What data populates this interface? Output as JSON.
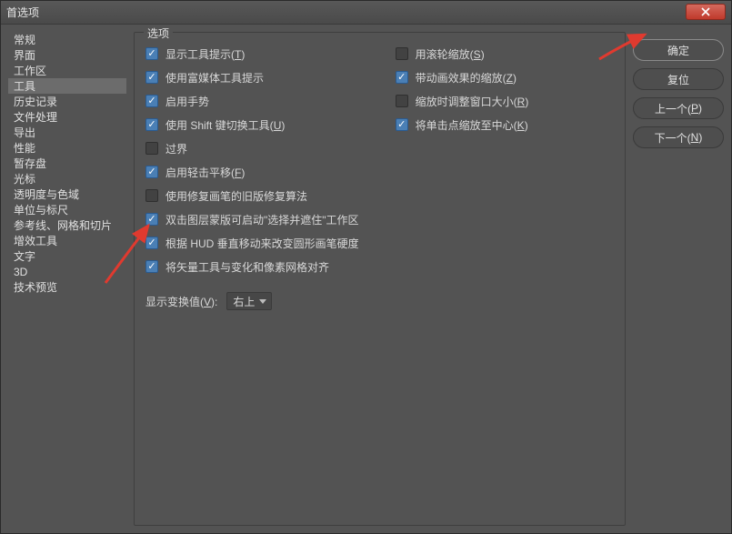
{
  "title": "首选项",
  "sidebar": {
    "items": [
      {
        "label": "常规"
      },
      {
        "label": "界面"
      },
      {
        "label": "工作区"
      },
      {
        "label": "工具",
        "selected": true
      },
      {
        "label": "历史记录"
      },
      {
        "label": "文件处理"
      },
      {
        "label": "导出"
      },
      {
        "label": "性能"
      },
      {
        "label": "暂存盘"
      },
      {
        "label": "光标"
      },
      {
        "label": "透明度与色域"
      },
      {
        "label": "单位与标尺"
      },
      {
        "label": "参考线、网格和切片"
      },
      {
        "label": "增效工具"
      },
      {
        "label": "文字"
      },
      {
        "label": "3D"
      },
      {
        "label": "技术预览"
      }
    ]
  },
  "group_label": "选项",
  "left_options": [
    {
      "checked": true,
      "label_pre": "显示工具提示(",
      "key": "T",
      "label_post": ")"
    },
    {
      "checked": true,
      "label_pre": "使用富媒体工具提示",
      "key": "",
      "label_post": ""
    },
    {
      "checked": true,
      "label_pre": "启用手势",
      "key": "",
      "label_post": ""
    },
    {
      "checked": true,
      "label_pre": "使用 Shift 键切换工具(",
      "key": "U",
      "label_post": ")"
    },
    {
      "checked": false,
      "label_pre": "过界",
      "key": "",
      "label_post": ""
    },
    {
      "checked": true,
      "label_pre": "启用轻击平移(",
      "key": "F",
      "label_post": ")"
    },
    {
      "checked": false,
      "label_pre": "使用修复画笔的旧版修复算法",
      "key": "",
      "label_post": ""
    },
    {
      "checked": true,
      "label_pre": "双击图层蒙版可启动\"选择并遮住\"工作区",
      "key": "",
      "label_post": ""
    },
    {
      "checked": true,
      "label_pre": "根据 HUD 垂直移动来改变圆形画笔硬度",
      "key": "",
      "label_post": ""
    },
    {
      "checked": true,
      "label_pre": "将矢量工具与变化和像素网格对齐",
      "key": "",
      "label_post": ""
    }
  ],
  "right_options": [
    {
      "checked": false,
      "label_pre": "用滚轮缩放(",
      "key": "S",
      "label_post": ")"
    },
    {
      "checked": true,
      "label_pre": "带动画效果的缩放(",
      "key": "Z",
      "label_post": ")"
    },
    {
      "checked": false,
      "label_pre": "缩放时调整窗口大小(",
      "key": "R",
      "label_post": ")"
    },
    {
      "checked": true,
      "label_pre": "将单击点缩放至中心(",
      "key": "K",
      "label_post": ")"
    }
  ],
  "show_transform": {
    "label_pre": "显示变换值(",
    "key": "V",
    "label_post": "):",
    "value": "右上"
  },
  "buttons": {
    "ok": "确定",
    "reset": "复位",
    "prev_pre": "上一个(",
    "prev_key": "P",
    "prev_post": ")",
    "next_pre": "下一个(",
    "next_key": "N",
    "next_post": ")"
  }
}
